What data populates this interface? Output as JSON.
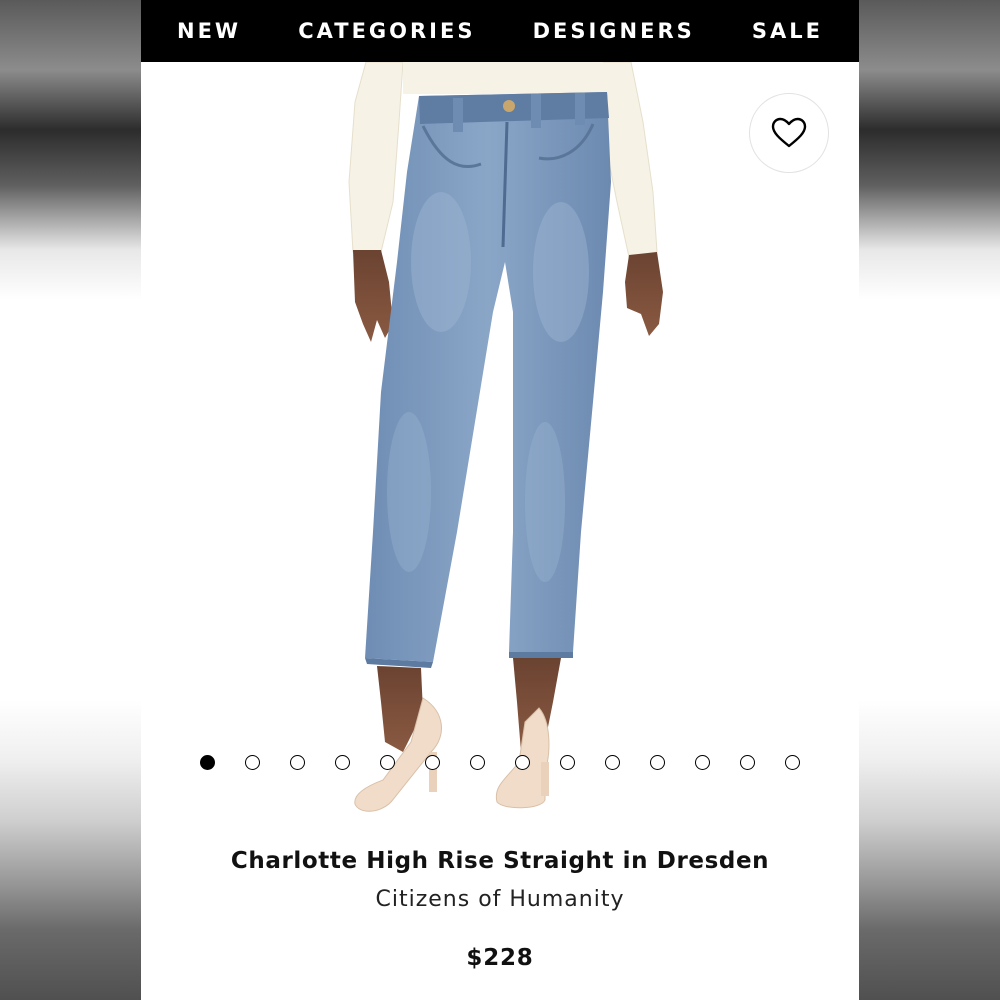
{
  "nav": {
    "items": [
      {
        "label": "NEW"
      },
      {
        "label": "CATEGORIES"
      },
      {
        "label": "DESIGNERS"
      },
      {
        "label": "SALE"
      }
    ]
  },
  "favorite": {
    "icon": "heart-outline-icon"
  },
  "gallery": {
    "image_count": 14,
    "active_index": 0
  },
  "product": {
    "title": "Charlotte High Rise Straight in Dresden",
    "brand": "Citizens of Humanity",
    "price": "$228"
  },
  "colors": {
    "nav_bg": "#000000",
    "nav_text": "#ffffff",
    "denim": "#7f9cc0",
    "text": "#111111"
  }
}
